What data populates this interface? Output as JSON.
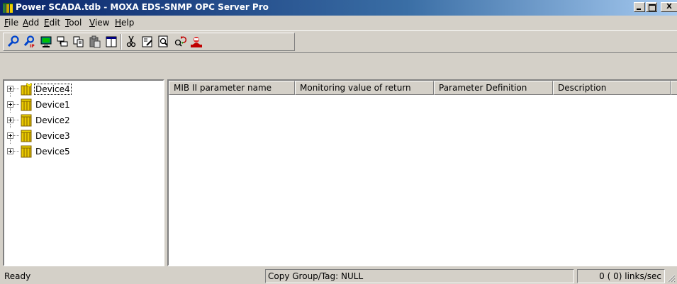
{
  "window": {
    "title": "Power SCADA.tdb - MOXA EDS-SNMP OPC Server Pro",
    "close_glyph": "X"
  },
  "menu": [
    {
      "label": "File",
      "accel": "F",
      "rest": "ile"
    },
    {
      "label": "Add",
      "accel": "A",
      "rest": "dd"
    },
    {
      "label": "Edit",
      "accel": "E",
      "rest": "dit"
    },
    {
      "label": "Tool",
      "accel": "T",
      "rest": "ool"
    },
    {
      "label": "View",
      "accel": "V",
      "rest": "iew"
    },
    {
      "label": "Help",
      "accel": "H",
      "rest": "elp"
    }
  ],
  "toolbar": {
    "buttons": [
      {
        "name": "search-device-icon"
      },
      {
        "name": "search-ip-icon"
      },
      {
        "name": "monitor-icon"
      },
      {
        "name": "network-group-icon"
      },
      {
        "name": "copy-icon"
      },
      {
        "name": "paste-icon"
      },
      {
        "name": "columns-icon"
      },
      {
        "name": "cut-icon"
      },
      {
        "name": "properties-icon"
      },
      {
        "name": "print-preview-icon"
      },
      {
        "name": "refresh-search-icon"
      },
      {
        "name": "alarm-user-icon"
      }
    ]
  },
  "tree": {
    "selected": "Device4",
    "items": [
      {
        "label": "Device4"
      },
      {
        "label": "Device1"
      },
      {
        "label": "Device2"
      },
      {
        "label": "Device3"
      },
      {
        "label": "Device5"
      }
    ]
  },
  "table": {
    "columns": [
      "MIB II parameter name",
      "Monitoring value of return",
      "Parameter Definition",
      "Description"
    ],
    "rows": []
  },
  "status": {
    "left": "Ready",
    "middle": "Copy Group/Tag: NULL",
    "right": "0 (    0) links/sec"
  },
  "colors": {
    "title_bar_start": "#0a246a",
    "title_bar_end": "#a6caf0",
    "face": "#d4d0c8",
    "device_icon": "#e8c800"
  }
}
